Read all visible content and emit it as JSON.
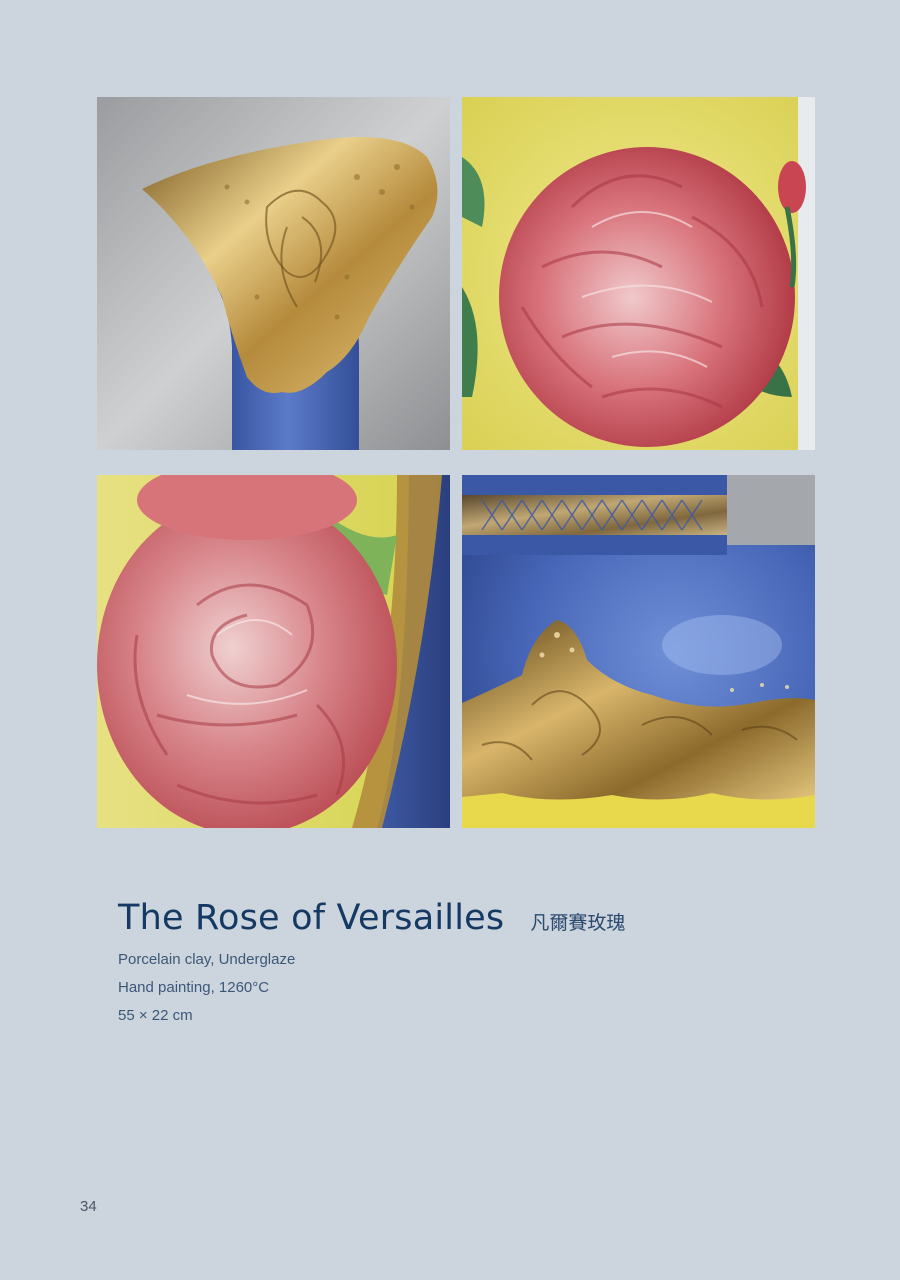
{
  "artwork": {
    "title": "The Rose of Versailles",
    "title_cn": "凡爾賽玫瑰",
    "specs": [
      "Porcelain clay, Underglaze",
      "Hand painting, 1260°C",
      "55 × 22 cm"
    ]
  },
  "photos": [
    {
      "subject": "gold-rim-vase-neck-photo"
    },
    {
      "subject": "red-peony-painting-photo"
    },
    {
      "subject": "red-rose-painting-photo"
    },
    {
      "subject": "gold-band-vase-shoulder-photo"
    }
  ],
  "colors": {
    "background": "#ccd4dd",
    "title": "#143a64",
    "vase_blue": "#4a6ab8",
    "gold": "#c9a24a",
    "rose_red": "#c64a56",
    "glaze_yellow": "#e8e060"
  },
  "page": {
    "number": "34"
  }
}
